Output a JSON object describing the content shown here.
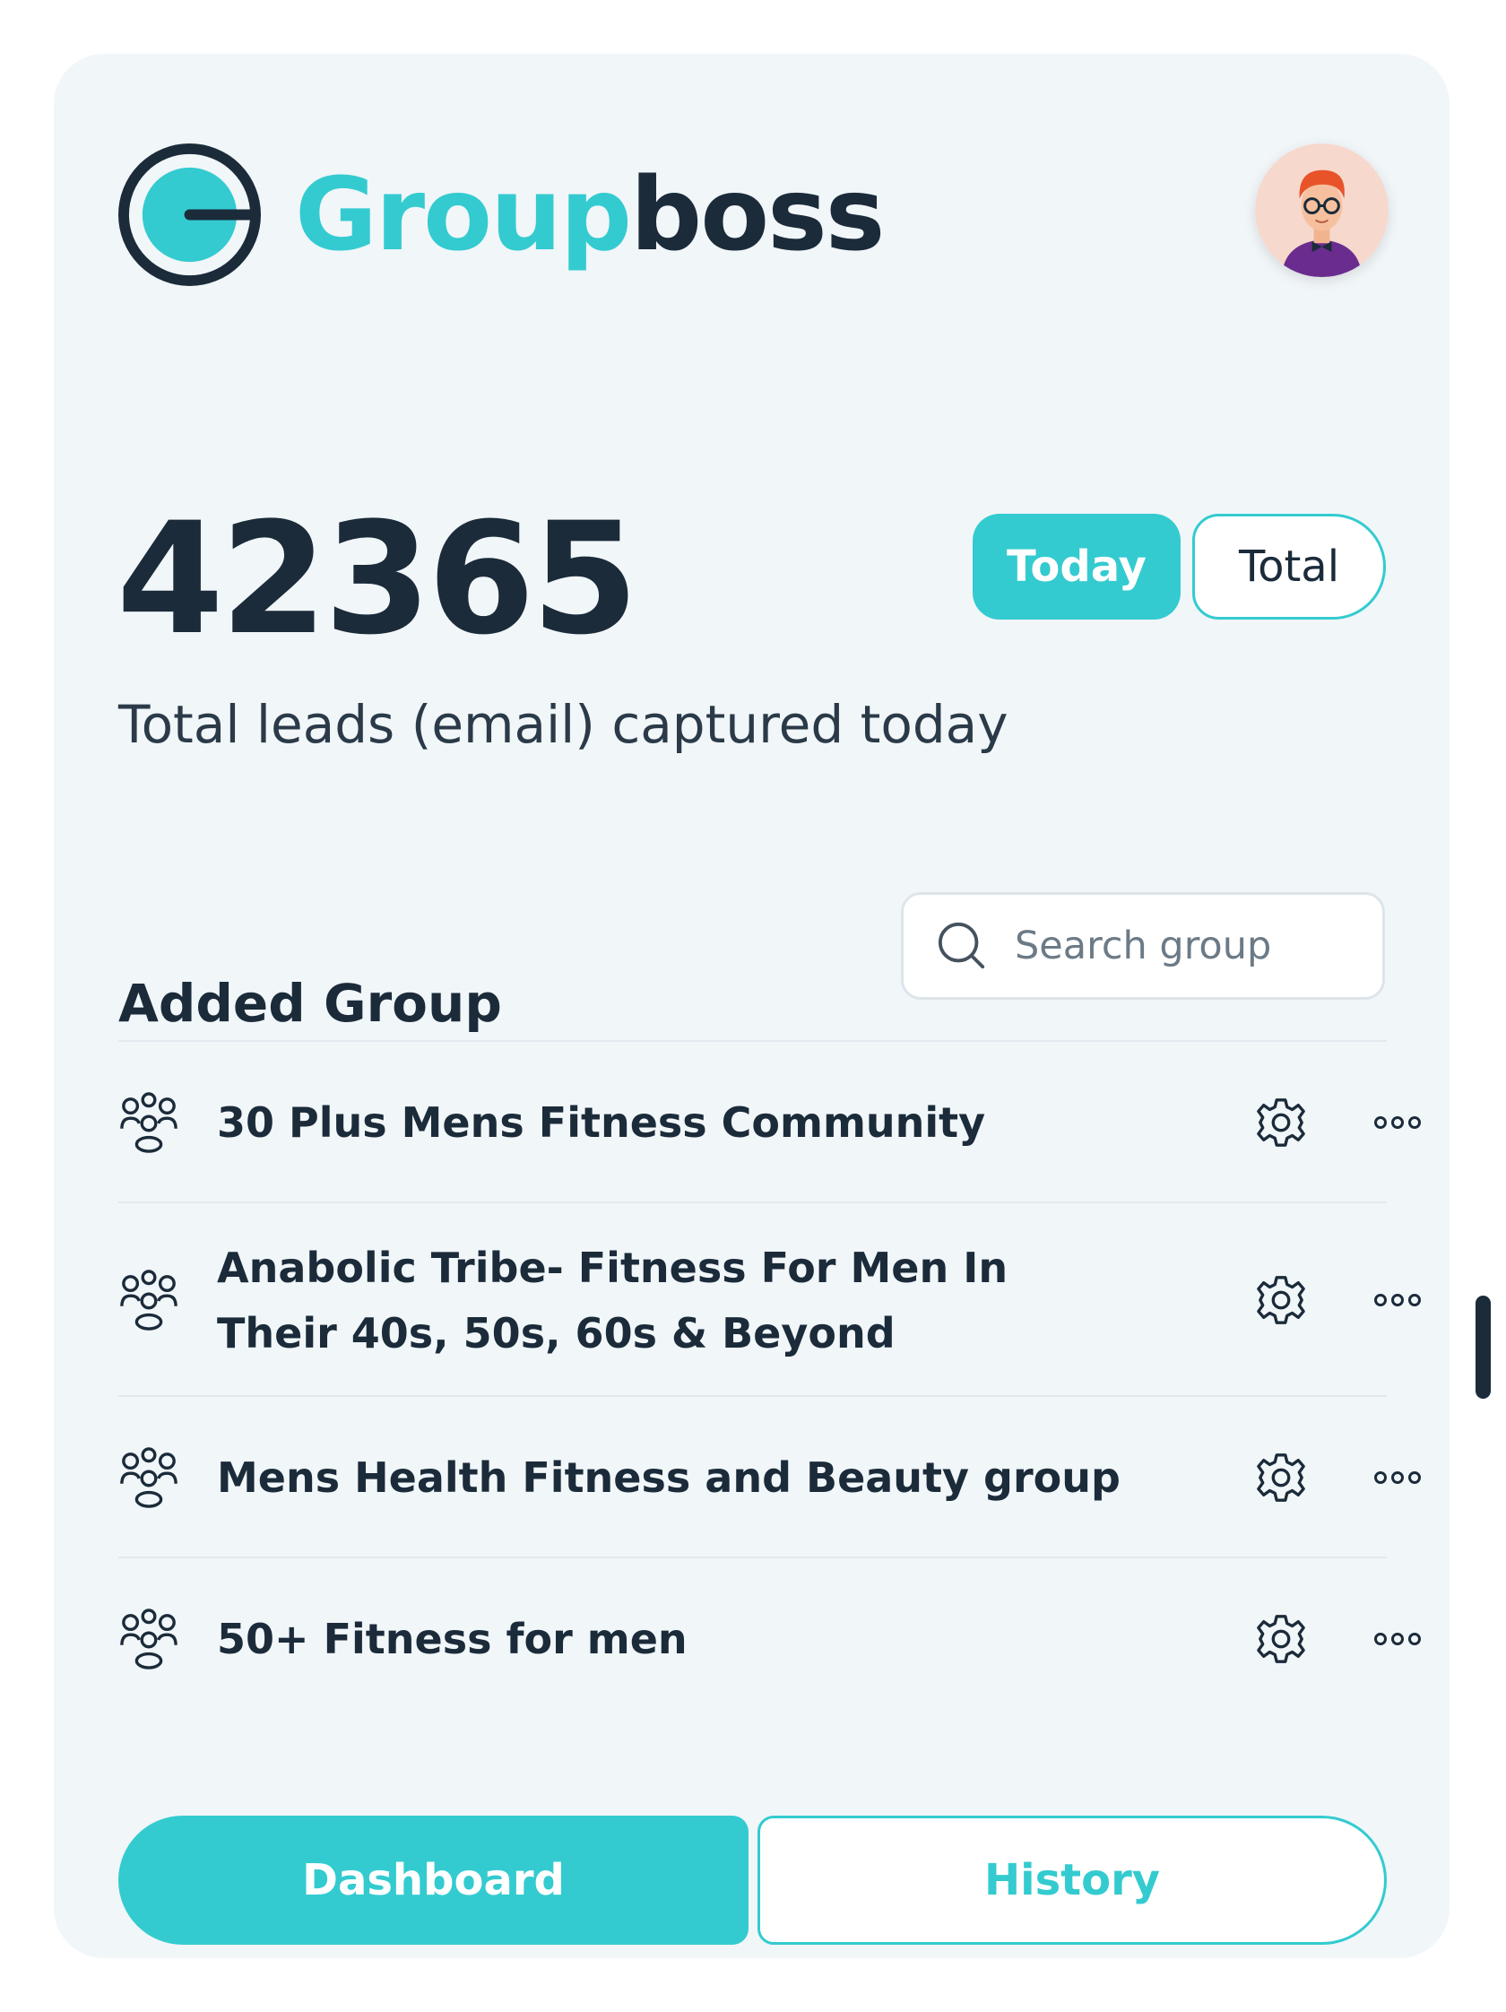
{
  "header": {
    "brand_part1": "Group",
    "brand_part2": "boss",
    "logo_icon": "groupboss-logo-icon",
    "avatar_icon": "user-avatar-icon"
  },
  "stats": {
    "value": "42365",
    "caption": "Total leads (email) captured today",
    "toggle": {
      "today_label": "Today",
      "total_label": "Total",
      "selected": "Today"
    }
  },
  "groups": {
    "title": "Added Group",
    "search_placeholder": "Search group",
    "search_value": "",
    "items": [
      {
        "label": "30 Plus Mens Fitness Community",
        "icon": "group-icon"
      },
      {
        "label": "Anabolic Tribe- Fitness For Men In Their 40s, 50s, 60s & Beyond",
        "icon": "group-icon"
      },
      {
        "label": "Mens Health Fitness and Beauty group",
        "icon": "group-icon"
      },
      {
        "label": "50+ Fitness for men",
        "icon": "group-icon"
      }
    ]
  },
  "nav": {
    "dashboard_label": "Dashboard",
    "history_label": "History",
    "active": "Dashboard"
  },
  "colors": {
    "accent": "#33cbd0",
    "text": "#1b2b3a",
    "panel_bg": "#f1f6f9"
  }
}
